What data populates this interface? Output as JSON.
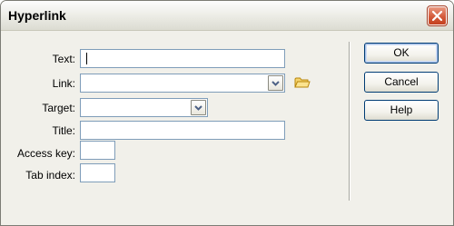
{
  "window": {
    "title": "Hyperlink"
  },
  "form": {
    "text_label": "Text:",
    "text_value": "",
    "link_label": "Link:",
    "link_value": "",
    "target_label": "Target:",
    "target_value": "",
    "title_label": "Title:",
    "title_value": "",
    "access_key_label": "Access key:",
    "access_key_value": "",
    "tab_index_label": "Tab index:",
    "tab_index_value": ""
  },
  "buttons": {
    "ok": "OK",
    "cancel": "Cancel",
    "help": "Help"
  },
  "icons": {
    "close": "close-icon",
    "browse": "folder-icon",
    "dropdown": "chevron-down-icon"
  },
  "colors": {
    "close_button": "#d45a3a",
    "field_border": "#7f9db9",
    "dialog_bg": "#f1f0ea"
  }
}
